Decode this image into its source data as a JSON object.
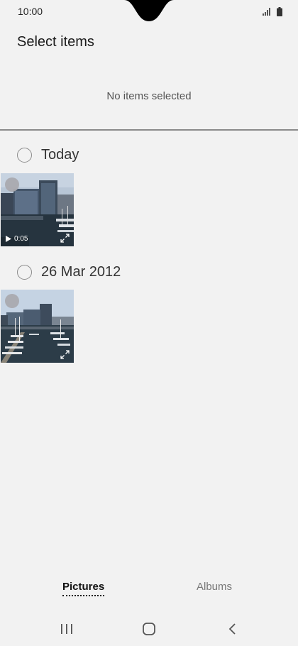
{
  "status_bar": {
    "time": "10:00",
    "icons": [
      "signal-icon",
      "battery-icon"
    ]
  },
  "header": {
    "title": "Select items",
    "selection_status": "No items selected"
  },
  "groups": [
    {
      "label": "Today",
      "items": [
        {
          "type": "video",
          "duration": "0:05",
          "icons": [
            "play-icon",
            "expand-icon"
          ]
        }
      ]
    },
    {
      "label": "26 Mar 2012",
      "items": [
        {
          "type": "photo",
          "icons": [
            "expand-icon"
          ]
        }
      ]
    }
  ],
  "tabs": [
    {
      "label": "Pictures",
      "active": true
    },
    {
      "label": "Albums",
      "active": false
    }
  ],
  "nav_bar": {
    "buttons": [
      "recents-icon",
      "home-icon",
      "back-icon"
    ]
  },
  "colors": {
    "background": "#f2f2f2",
    "divider": "#8a8a8a",
    "active_tab": "#111111",
    "inactive_tab": "#777777"
  }
}
